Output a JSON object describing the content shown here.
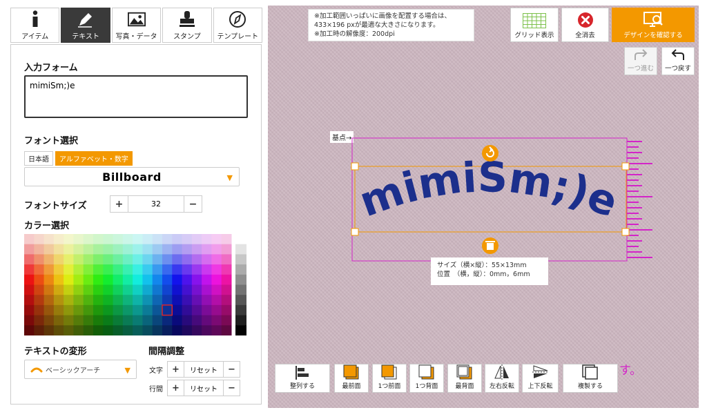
{
  "tabs": [
    {
      "label": "アイテム",
      "icon": "info-icon",
      "active": false
    },
    {
      "label": "テキスト",
      "icon": "pen-icon",
      "active": true
    },
    {
      "label": "写真・データ",
      "icon": "image-icon",
      "active": false
    },
    {
      "label": "スタンプ",
      "icon": "stamp-icon",
      "active": false
    },
    {
      "label": "テンプレート",
      "icon": "compass-icon",
      "active": false
    }
  ],
  "input_form": {
    "heading": "入力フォーム",
    "value": "mimiSm;)e"
  },
  "font_select": {
    "heading": "フォント選択",
    "chip_ja": "日本語",
    "chip_alpha": "アルファベット・数字",
    "selected": "Billboard"
  },
  "font_size": {
    "heading": "フォントサイズ",
    "value": "32",
    "plus": "+",
    "minus": "−"
  },
  "color_select": {
    "heading": "カラー選択"
  },
  "text_transform": {
    "heading": "テキストの変形",
    "selected": "ベーシックアーチ"
  },
  "spacing": {
    "heading": "間隔調整",
    "char_label": "文字",
    "line_label": "行間",
    "reset": "リセット",
    "plus": "+",
    "minus": "−"
  },
  "notice": {
    "line1": "※加工範囲いっぱいに画像を配置する場合は、",
    "line2": "433×196 pxが最適な大きさになります。",
    "line3": "※加工時の解像度：200dpi"
  },
  "top_buttons": {
    "grid": "グリッド表示",
    "clear": "全消去",
    "confirm": "デザインを確認する"
  },
  "history": {
    "redo": "一つ進む",
    "undo": "一つ戻す"
  },
  "canvas": {
    "origin_label": "基点→",
    "design_text": "mimiSm;)e",
    "text_color": "#1c2f8c",
    "size_line": "サイズ（横×縦）：55×13mm",
    "position_line": "位置　（横，縦）：0mm，6mm",
    "pink_text": "ます。"
  },
  "bottom_buttons": [
    "整列する",
    "最前面",
    "1つ前面",
    "1つ背面",
    "最背面",
    "左右反転",
    "上下反転",
    "複製する"
  ],
  "colors": {
    "accent": "#f39800",
    "active_tab": "#3a3a3a",
    "danger": "#d7262c",
    "magenta": "#d324c8",
    "grid_green": "#7cc04a"
  }
}
